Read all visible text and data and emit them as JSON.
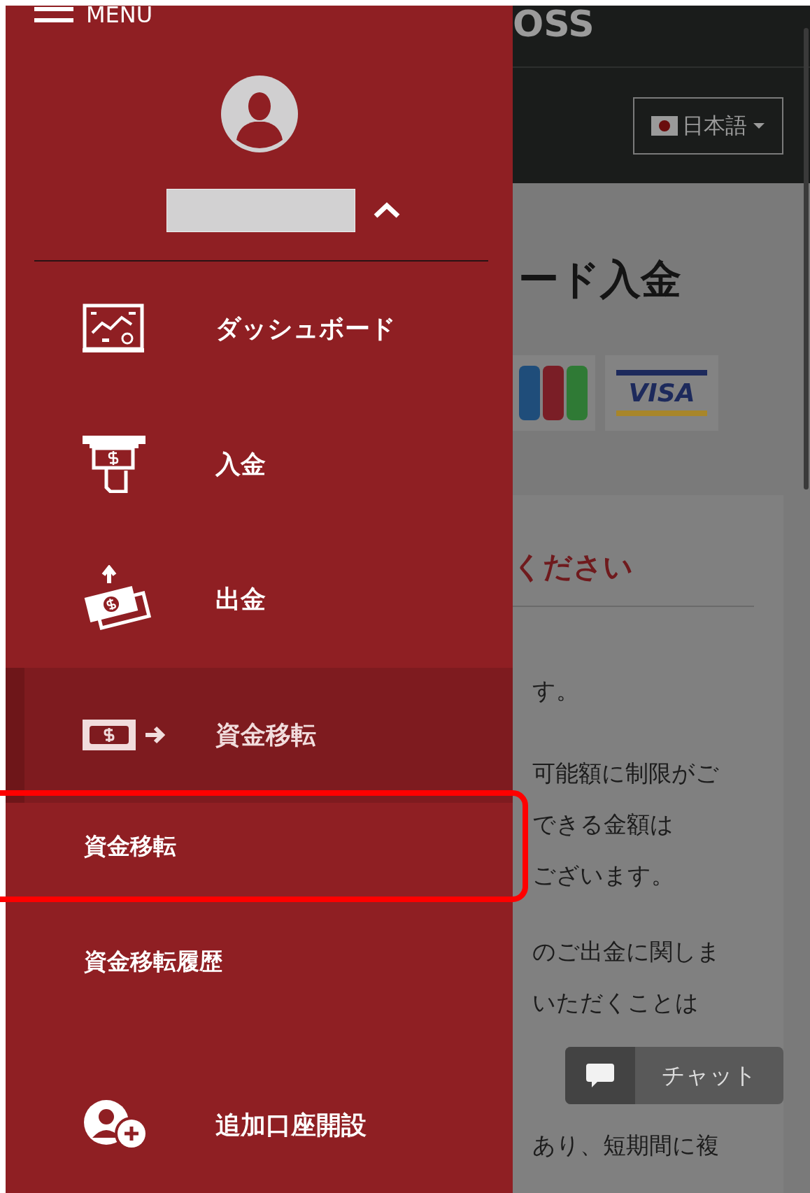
{
  "menu": {
    "label": "MENU",
    "user": {
      "expanded": true
    },
    "items": [
      {
        "kind": "dashboard",
        "label": "ダッシュボード",
        "selected": false,
        "expanded": false
      },
      {
        "kind": "deposit",
        "label": "入金",
        "selected": false,
        "expanded": false
      },
      {
        "kind": "withdraw",
        "label": "出金",
        "selected": false,
        "expanded": false
      },
      {
        "kind": "transfer",
        "label": "資金移転",
        "selected": true,
        "expanded": true,
        "children": [
          {
            "label": "資金移転",
            "annotated": true
          },
          {
            "label": "資金移転履歴",
            "annotated": false
          }
        ]
      },
      {
        "kind": "account",
        "label": "追加口座開設",
        "selected": false,
        "expanded": false
      }
    ]
  },
  "header": {
    "logo": "OSS",
    "language": "日本語"
  },
  "content": {
    "title": "ード入金",
    "cards": [
      {
        "kind": "jcb"
      },
      {
        "kind": "visa",
        "label": "VISA"
      }
    ],
    "heading": "ください",
    "paragraphs": [
      [
        "す。"
      ],
      [
        "可能額に制限がご",
        "できる金額は",
        "ございます。"
      ],
      [
        "のご出金に関しま",
        "いただくことは"
      ],
      [
        "あり、短期間に複"
      ]
    ]
  },
  "chat": {
    "label": "チャット"
  }
}
